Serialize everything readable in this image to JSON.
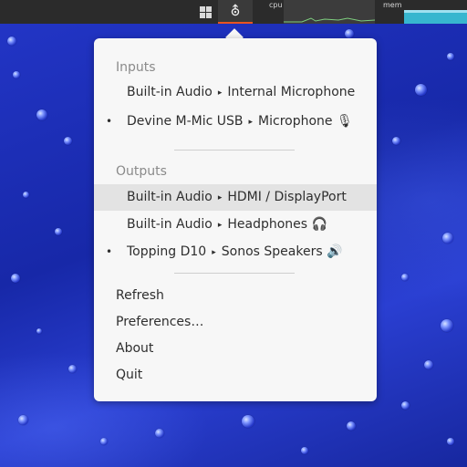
{
  "topbar": {
    "indicator_icon": "⛢",
    "cpu_label": "cpu",
    "mem_label": "mem"
  },
  "menu": {
    "inputs_title": "Inputs",
    "inputs": [
      {
        "device": "Built-in Audio",
        "arrow": "▸",
        "port": "Internal Microphone",
        "active": false
      },
      {
        "device": "Devine M-Mic USB",
        "arrow": "▸",
        "port": "Microphone 🎙",
        "active": true,
        "marker": "•"
      }
    ],
    "outputs_title": "Outputs",
    "outputs": [
      {
        "device": "Built-in Audio",
        "arrow": "▸",
        "port": "HDMI / DisplayPort",
        "active": false
      },
      {
        "device": "Built-in Audio",
        "arrow": "▸",
        "port": "Headphones 🎧",
        "active": false
      },
      {
        "device": "Topping D10",
        "arrow": "▸",
        "port": "Sonos Speakers 🔊",
        "active": true,
        "marker": "•"
      }
    ],
    "actions": {
      "refresh": "Refresh",
      "preferences": "Preferences…",
      "about": "About",
      "quit": "Quit"
    }
  }
}
